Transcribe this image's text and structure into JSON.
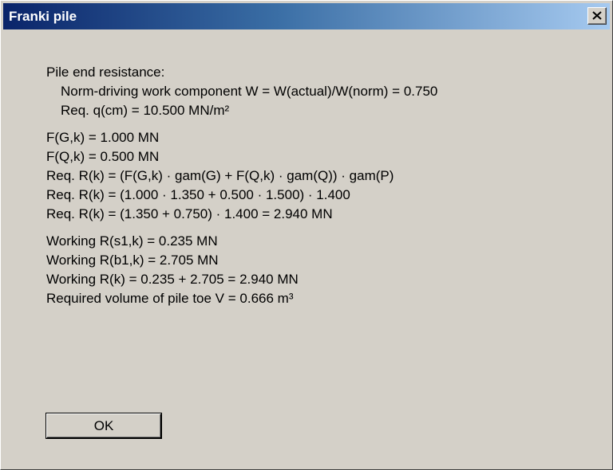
{
  "window": {
    "title": "Franki pile",
    "close_icon": "close-icon"
  },
  "content": {
    "section1": {
      "heading": "Pile end resistance:",
      "line1": "Norm-driving work component W  = W(actual)/W(norm) = 0.750",
      "line2": "Req. q(cm) = 10.500 MN/m²"
    },
    "section2": [
      "F(G,k) = 1.000 MN",
      "F(Q,k) = 0.500 MN",
      "Req. R(k) = (F(G,k) · gam(G) + F(Q,k) · gam(Q)) · gam(P)",
      "Req. R(k) = (1.000 · 1.350 + 0.500 · 1.500) · 1.400",
      "Req. R(k) = (1.350 + 0.750) · 1.400 = 2.940 MN"
    ],
    "section3": [
      "Working R(s1,k) = 0.235 MN",
      "Working R(b1,k) = 2.705 MN",
      "Working R(k) = 0.235 + 2.705 = 2.940 MN",
      "Required volume of pile toe V = 0.666 m³"
    ]
  },
  "buttons": {
    "ok_label": "OK"
  },
  "colors": {
    "titlebar_start": "#0a246a",
    "titlebar_end": "#a6caf0",
    "face": "#d4d0c8"
  }
}
